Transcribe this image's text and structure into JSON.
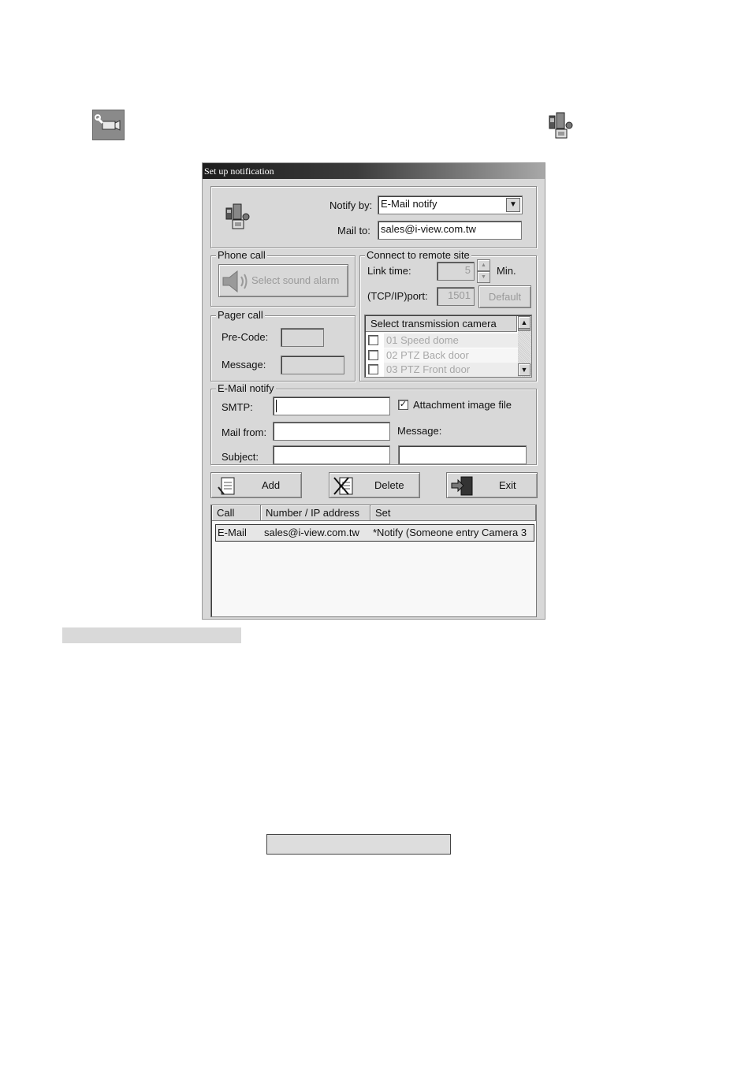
{
  "window": {
    "title": "Set up notification"
  },
  "notify": {
    "notify_by_label": "Notify by:",
    "notify_by_value": "E-Mail notify",
    "mail_to_label": "Mail to:",
    "mail_to_value": "sales@i-view.com.tw"
  },
  "phone_call": {
    "legend": "Phone call",
    "select_sound_label": "Select sound alarm"
  },
  "pager_call": {
    "legend": "Pager call",
    "pre_code_label": "Pre-Code:",
    "message_label": "Message:"
  },
  "remote": {
    "legend": "Connect to remote site",
    "link_time_label": "Link time:",
    "link_time_value": "5",
    "link_time_unit": "Min.",
    "port_label": "(TCP/IP)port:",
    "port_value": "1501",
    "default_button": "Default",
    "camera_list_header": "Select transmission camera",
    "cameras": [
      "01 Speed dome",
      "02 PTZ Back door",
      "03 PTZ Front door"
    ]
  },
  "email": {
    "legend": "E-Mail notify",
    "smtp_label": "SMTP:",
    "mail_from_label": "Mail from:",
    "subject_label": "Subject:",
    "attachment_label": "Attachment image file",
    "attachment_checked": true,
    "message_label": "Message:"
  },
  "actions": {
    "add": "Add",
    "delete": "Delete",
    "exit": "Exit"
  },
  "table": {
    "columns": [
      "Call",
      "Number / IP address",
      "Set"
    ],
    "rows": [
      {
        "call": "E-Mail",
        "address": "sales@i-view.com.tw",
        "set": "*Notify (Someone entry Camera 3"
      }
    ]
  }
}
